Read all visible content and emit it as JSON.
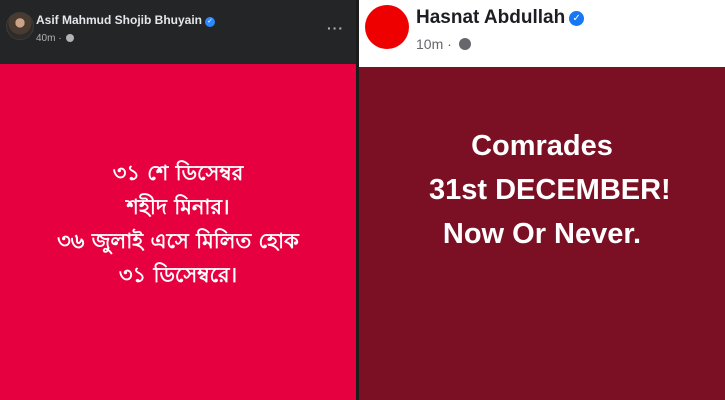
{
  "left_post": {
    "author": "Asif Mahmud Shojib Bhuyain",
    "verified_glyph": "✓",
    "time": "40m",
    "separator": "·",
    "more_glyph": "···",
    "background_color": "#e7003f",
    "lines": [
      "৩১ শে ডিসেম্বর",
      "শহীদ মিনার।",
      "৩৬ জুলাই এসে মিলিত হোক",
      "৩১ ডিসেম্বরে।"
    ]
  },
  "right_post": {
    "author": "Hasnat Abdullah",
    "verified_glyph": "✓",
    "time": "10m",
    "separator": "·",
    "background_color": "#7b1024",
    "lines": [
      "Comrades",
      "31st DECEMBER!",
      "Now Or Never."
    ]
  },
  "icons": {
    "left_avatar": "profile-photo",
    "right_avatar": "red-circle-avatar",
    "verified": "verified-badge-icon",
    "globe": "globe-icon",
    "more": "more-options-icon"
  }
}
